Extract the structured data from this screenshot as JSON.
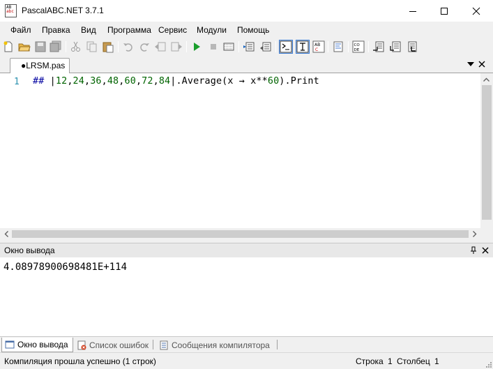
{
  "window": {
    "title": "PascalABC.NET 3.7.1",
    "icon_text_top": "AB",
    "icon_text_bottom": "abc"
  },
  "menu": {
    "items": [
      "Файл",
      "Правка",
      "Вид",
      "Программа",
      "Сервис",
      "Модули",
      "Помощь"
    ]
  },
  "toolbar": {
    "buttons": [
      "new-file-icon",
      "open-file-icon",
      "save-icon",
      "save-all-icon",
      "cut-icon",
      "copy-icon",
      "paste-icon",
      "undo-icon",
      "redo-icon",
      "navigate-back-icon",
      "navigate-forward-icon",
      "run-icon",
      "stop-icon",
      "compile-icon",
      "debug-step-icon",
      "debug-step-over-icon",
      "console-icon",
      "text-mode-icon",
      "abc-mode-icon",
      "formatter-icon",
      "code-icon",
      "breakpoint-1-icon",
      "breakpoint-2-icon",
      "breakpoint-3-icon"
    ]
  },
  "editor": {
    "tab_label": "●LRSM.pas",
    "line_number": "1",
    "code": {
      "kw": "##",
      "bar1": "|",
      "n1": "12",
      "n2": "24",
      "n3": "36",
      "n4": "48",
      "n5": "60",
      "n6": "72",
      "n7": "84",
      "bar2": "|",
      "method": ".Average(x → x**",
      "exp": "60",
      "tail": ").Print"
    }
  },
  "output": {
    "title": "Окно вывода",
    "text": "4.08978900698481E+114"
  },
  "bottom_tabs": [
    {
      "label": "Окно вывода",
      "active": true
    },
    {
      "label": "Список ошибок",
      "active": false
    },
    {
      "label": "Сообщения компилятора",
      "active": false
    }
  ],
  "status": {
    "message": "Компиляция прошла успешно (1 строк)",
    "row_label": "Строка",
    "row_value": "1",
    "col_label": "Столбец",
    "col_value": "1"
  }
}
